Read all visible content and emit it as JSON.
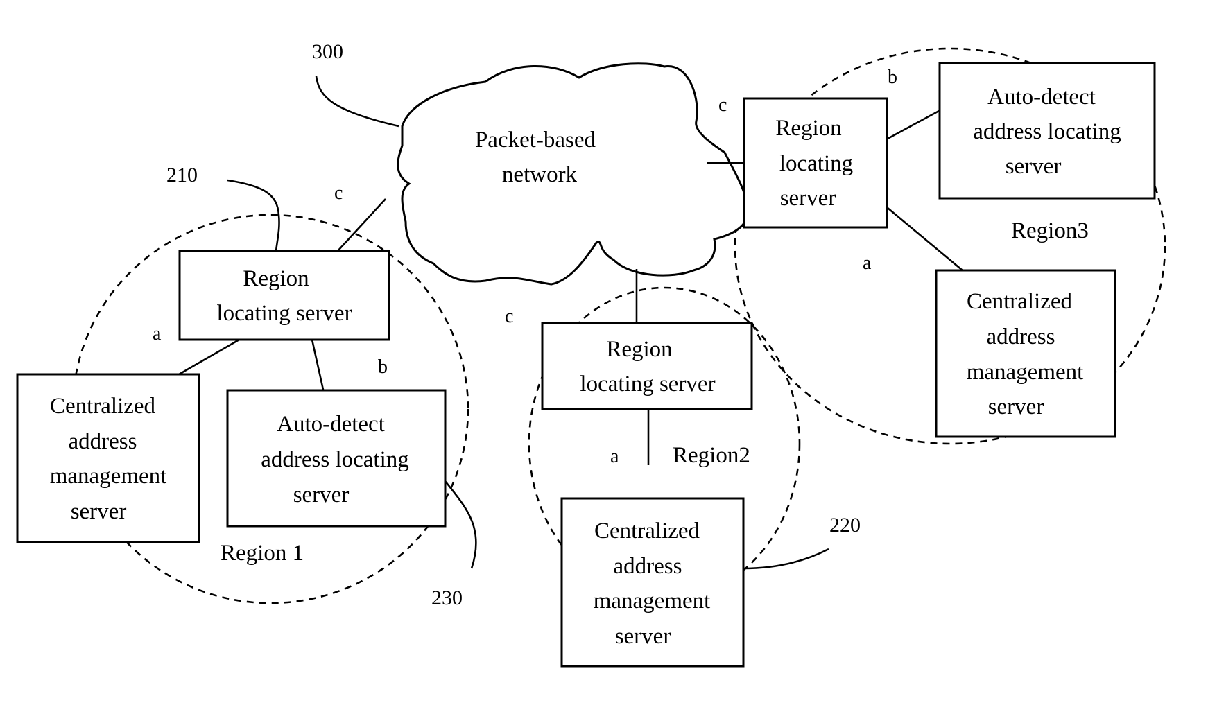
{
  "colors": {
    "ink": "#000000",
    "background": "#ffffff"
  },
  "network": {
    "lines": [
      "Packet-based",
      "network"
    ],
    "ref": "300"
  },
  "regions": [
    {
      "name": "Region 1",
      "label": "Region 1",
      "ref_region_server": "210",
      "ref_autodetect": "230",
      "region_server": {
        "lines": [
          "Region",
          "locating server"
        ]
      },
      "centralized": {
        "lines": [
          "Centralized",
          "address",
          "management",
          "server"
        ]
      },
      "autodetect": {
        "lines": [
          "Auto-detect",
          "address locating",
          "server"
        ]
      },
      "links": {
        "to_network": "c",
        "to_centralized": "a",
        "to_autodetect": "b"
      }
    },
    {
      "name": "Region 2",
      "label": "Region2",
      "ref_centralized": "220",
      "region_server": {
        "lines": [
          "Region",
          "locating server"
        ]
      },
      "centralized": {
        "lines": [
          "Centralized",
          "address",
          "management",
          "server"
        ]
      },
      "links": {
        "to_network": "c",
        "to_centralized": "a"
      }
    },
    {
      "name": "Region 3",
      "label": "Region3",
      "region_server": {
        "lines": [
          "Region",
          "locating",
          "server"
        ]
      },
      "autodetect": {
        "lines": [
          "Auto-detect",
          "address locating",
          "server"
        ]
      },
      "centralized": {
        "lines": [
          "Centralized",
          "address",
          "management",
          "server"
        ]
      },
      "links": {
        "to_network": "c",
        "to_autodetect": "b",
        "to_centralized": "a"
      }
    }
  ]
}
